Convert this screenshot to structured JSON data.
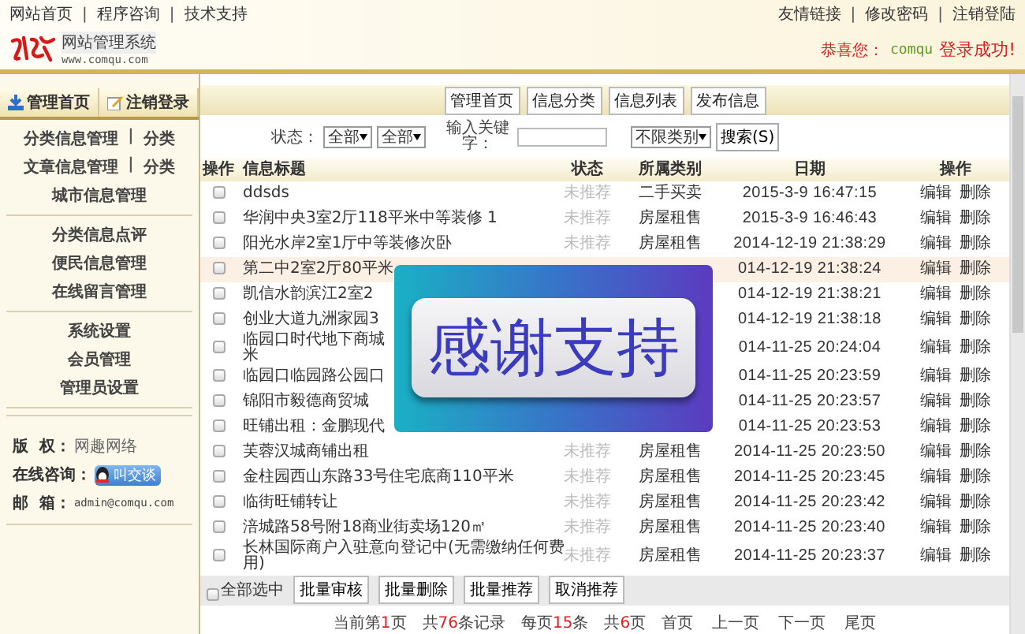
{
  "header": {
    "top_links": [
      "网站首页",
      "程序咨询",
      "技术支持"
    ],
    "separator": "|",
    "brand_title": "网站管理系统",
    "brand_url": "www.comqu.com",
    "right_links": [
      "友情链接",
      "修改密码",
      "注销登陆"
    ],
    "greeting": {
      "prefix": "恭喜您：",
      "user": "comqu",
      "suffix": "登录成功!"
    }
  },
  "sidebar": {
    "top_buttons": [
      {
        "label": "管理首页"
      },
      {
        "label": "注销登录"
      }
    ],
    "separator": "|",
    "groups": [
      [
        {
          "links": [
            "分类信息管理",
            "分类"
          ]
        },
        {
          "links": [
            "文章信息管理",
            "分类"
          ]
        },
        {
          "links": [
            "城市信息管理"
          ]
        }
      ],
      [
        {
          "links": [
            "分类信息点评"
          ]
        },
        {
          "links": [
            "便民信息管理"
          ]
        },
        {
          "links": [
            "在线留言管理"
          ]
        }
      ],
      [
        {
          "links": [
            "系统设置"
          ]
        },
        {
          "links": [
            "会员管理"
          ]
        },
        {
          "links": [
            "管理员设置"
          ]
        }
      ]
    ],
    "info": {
      "copyright_label": "版  权：",
      "copyright_value": "网趣网络",
      "consult_label": "在线咨询：",
      "qq_button": "叫交谈",
      "email_label": "邮  箱：",
      "email": "admin@comqu.com"
    }
  },
  "main": {
    "toolbar": [
      "管理首页",
      "信息分类",
      "信息列表",
      "发布信息"
    ],
    "filter": {
      "status_label": "状态：",
      "selects": [
        "全部",
        "全部"
      ],
      "keyword_label": "输入关键字：",
      "category_select": "不限类别",
      "search_button": "搜索(S)"
    },
    "table": {
      "columns": [
        "操作",
        "信息标题",
        "状态",
        "所属类别",
        "日期",
        "操作"
      ],
      "rows": [
        {
          "checked": false,
          "highlighted": false,
          "title": "ddsds",
          "status": "未推荐",
          "category": "二手买卖",
          "date": "2015-3-9 16:47:15",
          "actions": [
            "编辑",
            "删除"
          ]
        },
        {
          "checked": false,
          "highlighted": false,
          "title": "华润中央3室2厅118平米中等装修 1",
          "status": "未推荐",
          "category": "房屋租售",
          "date": "2015-3-9 16:46:43",
          "actions": [
            "编辑",
            "删除"
          ]
        },
        {
          "checked": false,
          "highlighted": false,
          "title": "阳光水岸2室1厅中等装修次卧",
          "status": "未推荐",
          "category": "房屋租售",
          "date": "2014-12-19 21:38:29",
          "actions": [
            "编辑",
            "删除"
          ]
        },
        {
          "checked": false,
          "highlighted": true,
          "title": "第二中2室2厅80平米",
          "date": "014-12-19 21:38:24",
          "actions": [
            "编辑",
            "删除"
          ]
        },
        {
          "checked": false,
          "highlighted": false,
          "title": "凯信水韵滨江2室2",
          "date": "014-12-19 21:38:21",
          "actions": [
            "编辑",
            "删除"
          ]
        },
        {
          "checked": false,
          "highlighted": false,
          "title": "创业大道九洲家园3",
          "date": "014-12-19 21:38:18",
          "actions": [
            "编辑",
            "删除"
          ]
        },
        {
          "checked": false,
          "highlighted": false,
          "title": "临园口时代地下商城",
          "title_cont": "米",
          "date": "014-11-25 20:24:04",
          "actions": [
            "编辑",
            "删除"
          ]
        },
        {
          "checked": false,
          "highlighted": false,
          "title": "临园口临园路公园口",
          "date": "014-11-25 20:23:59",
          "actions": [
            "编辑",
            "删除"
          ]
        },
        {
          "checked": false,
          "highlighted": false,
          "title": "锦阳市毅德商贸城",
          "date": "014-11-25 20:23:57",
          "actions": [
            "编辑",
            "删除"
          ]
        },
        {
          "checked": false,
          "highlighted": false,
          "title": "旺铺出租：金鹏现代",
          "date": "014-11-25 20:23:53",
          "actions": [
            "编辑",
            "删除"
          ]
        },
        {
          "checked": false,
          "highlighted": false,
          "title": "芙蓉汉城商铺出租",
          "status": "未推荐",
          "category": "房屋租售",
          "date": "2014-11-25 20:23:50",
          "actions": [
            "编辑",
            "删除"
          ]
        },
        {
          "checked": false,
          "highlighted": false,
          "title": "金柱园西山东路33号住宅底商110平米",
          "status": "未推荐",
          "category": "房屋租售",
          "date": "2014-11-25 20:23:45",
          "actions": [
            "编辑",
            "删除"
          ]
        },
        {
          "checked": false,
          "highlighted": false,
          "title": "临街旺铺转让",
          "status": "未推荐",
          "category": "房屋租售",
          "date": "2014-11-25 20:23:42",
          "actions": [
            "编辑",
            "删除"
          ]
        },
        {
          "checked": false,
          "highlighted": false,
          "title": "涪城路58号附18商业街卖场120㎡",
          "status": "未推荐",
          "category": "房屋租售",
          "date": "2014-11-25 20:23:40",
          "actions": [
            "编辑",
            "删除"
          ]
        },
        {
          "checked": false,
          "highlighted": false,
          "title": "长林国际商户入驻意向登记中(无需缴纳任何费",
          "title_cont": "用)",
          "status": "未推荐",
          "category": "房屋租售",
          "date": "2014-11-25 20:23:37",
          "actions": [
            "编辑",
            "删除"
          ]
        }
      ]
    },
    "overlay": {
      "text": "感谢支持"
    },
    "footer": {
      "select_all": {
        "label": "全部选中",
        "checked": false
      },
      "buttons": [
        "批量审核",
        "批量删除",
        "批量推荐",
        "取消推荐"
      ]
    },
    "pagination": {
      "items": [
        {
          "pre": "当前第",
          "num": "1",
          "post": "页"
        },
        {
          "pre": "共",
          "num": "76",
          "post": "条记录"
        },
        {
          "pre": "每页",
          "num": "15",
          "post": "条"
        },
        {
          "pre": "共",
          "num": "6",
          "post": "页"
        }
      ],
      "links": [
        "首页",
        "上一页",
        "下一页",
        "尾页"
      ]
    }
  }
}
